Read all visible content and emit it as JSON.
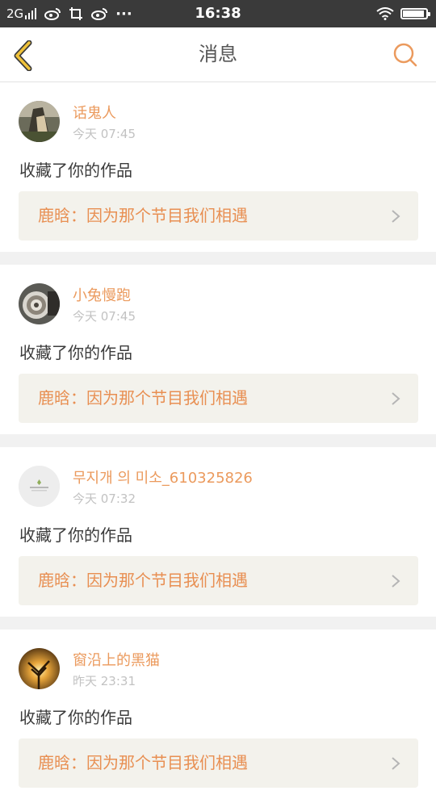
{
  "status_bar": {
    "network": "2G",
    "time": "16:38",
    "more": "···"
  },
  "header": {
    "title": "消息",
    "back_icon": "chevron-left-icon",
    "search_icon": "search-icon"
  },
  "colors": {
    "accent": "#eb9a5d",
    "back": "#f0c23a",
    "card_link_bg": "#f3f2ec"
  },
  "messages": [
    {
      "user": "话鬼人",
      "time": "今天 07:45",
      "action": "收藏了你的作品",
      "work": "鹿晗：因为那个节目我们相遇"
    },
    {
      "user": "小兔慢跑",
      "time": "今天 07:45",
      "action": "收藏了你的作品",
      "work": "鹿晗：因为那个节目我们相遇"
    },
    {
      "user": "무지개 의 미소_610325826",
      "time": "今天 07:32",
      "action": "收藏了你的作品",
      "work": "鹿晗：因为那个节目我们相遇"
    },
    {
      "user": "窗沿上的黑猫",
      "time": "昨天 23:31",
      "action": "收藏了你的作品",
      "work": "鹿晗：因为那个节目我们相遇"
    }
  ]
}
